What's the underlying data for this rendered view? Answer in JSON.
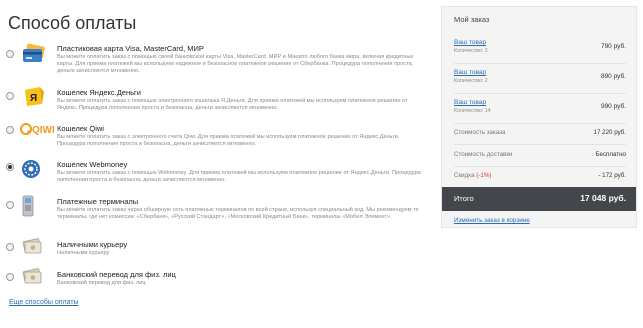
{
  "page": {
    "heading": "Способ оплаты",
    "more_link": "Еще способы оплаты"
  },
  "methods": [
    {
      "title": "Пластиковая карта Visa, MasterCard, МИР",
      "description": "Вы можете оплатить заказ с помощью своей банковской карты Visa, MasterCard, МИР и Maestro любого банка мира, включая кредитные карты. Для приема платежей мы используем надежное и безопасное платежное решение от Сбербанка. Процедура пополнения проста, деньги зачисляются мгновенно.",
      "icon": "bank-card-icon",
      "selected": false
    },
    {
      "title": "Кошелек Яндекс.Деньги",
      "description": "Вы можете оплатить заказ с помощью электронного кошелька Я.Деньги. Для приема платежей мы используем платежное решение от Яндекс. Процедура пополнения проста и безопасна, деньги зачисляются мгновенно.",
      "icon": "yandex-money-icon",
      "selected": false
    },
    {
      "title": "Кошелек Qiwi",
      "description": "Вы можете оплатить заказ с электронного счета Qiwi. Для приема платежей мы используем платежное решение от Яндекс.Деньги. Процедура пополнения проста и безопасна, деньги зачисляются мгновенно.",
      "icon": "qiwi-icon",
      "logo_text": "QIWI",
      "selected": false
    },
    {
      "title": "Кошелек Webmoney",
      "description": "Вы можете оплатить заказ с помощью Webmoney. Для приема платежей мы используем платежное решение от Яндекс.Деньги. Процедура пополнения проста и безопасна, деньги зачисляются мгновенно.",
      "icon": "webmoney-icon",
      "selected": true
    },
    {
      "title": "Платежные терминалы",
      "description": "Вы можете оплатить заказ через обширную сеть платежных терминалов по всей стране, используя специальный код. Мы рекомендуем те терминалы, где нет комиссии: «Сбербанк», «Русский Стандарт», «Московский Кредитный Банк», терминалы «Мобил Элемент».",
      "icon": "payment-terminal-icon",
      "selected": false
    },
    {
      "title": "Наличными курьеру",
      "description": "Наличными курьеру",
      "icon": "cash-icon",
      "selected": false
    },
    {
      "title": "Банковский перевод для физ. лиц",
      "description": "Банковский перевод для физ. лиц",
      "icon": "bank-transfer-icon",
      "selected": false
    }
  ],
  "order": {
    "title": "Мой заказ",
    "items": [
      {
        "name": "Ваш товар",
        "qty": "Количество: 2",
        "price": "790 руб."
      },
      {
        "name": "Ваш товар",
        "qty": "Количество: 2",
        "price": "890 руб."
      },
      {
        "name": "Ваш товар",
        "qty": "Количество: 14",
        "price": "990 руб."
      }
    ],
    "cost_label": "Стоимость заказа",
    "cost_value": "17 220 руб.",
    "delivery_label": "Стоимость доставки",
    "delivery_value": "Бесплатно",
    "discount_label": "Скидка",
    "discount_pct": "(-1%)",
    "discount_value": "- 172 руб.",
    "total_label": "Итого",
    "total_value": "17 048 руб.",
    "change_link": "Изменить заказ в корзине"
  },
  "colors": {
    "link": "#2a6fb6",
    "total_bg": "#43464b",
    "discount": "#d9342b",
    "panel_bg": "#f4f4f5"
  }
}
